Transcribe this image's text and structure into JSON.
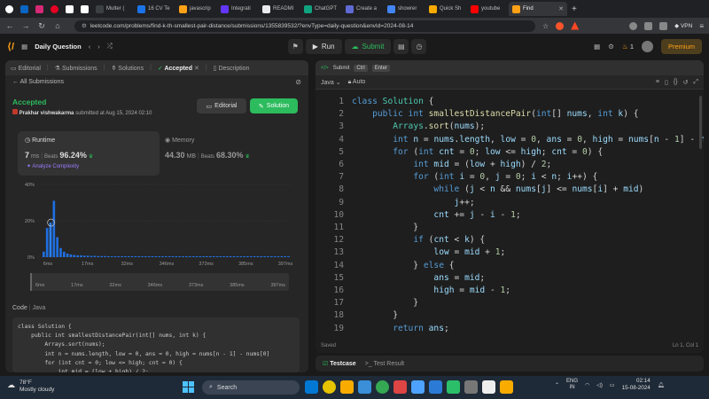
{
  "browser": {
    "tabs": [
      {
        "label": "Multer (",
        "color": "#3c4043"
      },
      {
        "label": "16 CV Te",
        "color": "#1a73e8"
      },
      {
        "label": "javascrip",
        "color": "#ffa116"
      },
      {
        "label": "Integrati",
        "color": "#6236ff"
      },
      {
        "label": "READMI",
        "color": "#e8eaed"
      },
      {
        "label": "ChatGPT",
        "color": "#10a37f"
      },
      {
        "label": "Create a",
        "color": "#5f6ad4"
      },
      {
        "label": "showrer",
        "color": "#4285f4"
      },
      {
        "label": "Quick Sh",
        "color": "#f9ab00"
      },
      {
        "label": "youtube",
        "color": "#ff0000"
      }
    ],
    "active_tab": "Find",
    "url": "leetcode.com/problems/find-k-th-smallest-pair-distance/submissions/1355839532/?envType=daily-question&envId=2024-08-14",
    "vpn_label": "VPN"
  },
  "header": {
    "title": "Daily Question",
    "run": "Run",
    "submit": "Submit",
    "streak": "1",
    "premium": "Premium"
  },
  "left": {
    "tabs": [
      "Editorial",
      "Submissions",
      "Solutions",
      "Accepted",
      "Description"
    ],
    "all_submissions": "All Submissions",
    "status": "Accepted",
    "user": "Prakhar vishwakarma",
    "submitted": "submitted at Aug 15, 2024 02:10",
    "editorial_btn": "Editorial",
    "solution_btn": "Solution",
    "runtime_label": "Runtime",
    "runtime_value": "7",
    "runtime_unit": "ms",
    "beats_label": "Beats",
    "runtime_beats": "96.24%",
    "analyze": "Analyze Complexity",
    "memory_label": "Memory",
    "memory_value": "44.30",
    "memory_unit": "MB",
    "memory_beats": "68.30%",
    "code_label": "Code",
    "code_lang": "Java",
    "code_preview": [
      "class Solution {",
      "    public int smallestDistancePair(int[] nums, int k) {",
      "        Arrays.sort(nums);",
      "        int n = nums.length, low = 0, ans = 0, high = nums[n - 1] - nums[0]",
      "        for (int cnt = 0; low <= high; cnt = 0) {",
      "            int mid = (low + high) / 2;"
    ]
  },
  "chart_data": {
    "type": "bar",
    "title": "",
    "xlabel": "",
    "ylabel": "",
    "ylim": [
      0,
      40
    ],
    "ytick_labels": [
      "40%",
      "20%",
      "0%"
    ],
    "xtick_labels": [
      "6ms",
      "17ms",
      "32ms",
      "346ms",
      "373ms",
      "385ms",
      "397ms"
    ],
    "highlight_index": 2,
    "highlight_color": "#2882ff",
    "bar_color": "#1f6fe0",
    "values": [
      3,
      16,
      19,
      31,
      11,
      5,
      3,
      2,
      1.5,
      1.2,
      1,
      1,
      0.8,
      0.8,
      0.7,
      0.7,
      0.6,
      0.6,
      0.6,
      0.5,
      0.5,
      0.5,
      0.5,
      0.5,
      0.5,
      0.5,
      0.5,
      0.5,
      0.5,
      0.5,
      0.5,
      0.5,
      0.5,
      0.5,
      0.5,
      0.5,
      0.5,
      0.5,
      0.5,
      0.5,
      0.5,
      0.5,
      0.5,
      0.5,
      0.5,
      0.5,
      0.5,
      0.5,
      0.5,
      0.5,
      0.5,
      0.5,
      0.5,
      0.5,
      0.5,
      0.5,
      0.5,
      0.5,
      0.5,
      0.5,
      0.5,
      0.5,
      0.5,
      0.5,
      0.5,
      0.5,
      0.5,
      0.5,
      0.5,
      0.5,
      0.5,
      0.5,
      0.5
    ]
  },
  "editor": {
    "tabs": {
      "submit": "Submit",
      "ctrl": "Ctrl",
      "enter": "Enter"
    },
    "language": "Java",
    "auto": "Auto",
    "saved": "Saved",
    "cursor": "Ln 1, Col 1",
    "lines": [
      {
        "n": "1",
        "html": "<span class='kw'>class</span> <span class='ty'>Solution</span> {"
      },
      {
        "n": "2",
        "html": "    <span class='kw'>public int</span> <span class='fn'>smallestDistancePair</span>(<span class='kw'>int</span>[] <span class='vr'>nums</span>, <span class='kw'>int</span> <span class='vr'>k</span>) {"
      },
      {
        "n": "3",
        "html": "        <span class='ty'>Arrays</span>.<span class='fn'>sort</span>(<span class='vr'>nums</span>);"
      },
      {
        "n": "4",
        "html": "        <span class='kw'>int</span> <span class='vr'>n</span> = <span class='vr'>nums</span>.<span class='vr'>length</span>, <span class='vr'>low</span> = <span class='nm'>0</span>, <span class='vr'>ans</span> = <span class='nm'>0</span>, <span class='vr'>high</span> = <span class='vr'>nums</span>[<span class='vr'>n</span> - <span class='nm'>1</span>] - <span class='vr'>nu</span>"
      },
      {
        "n": "5",
        "html": "        <span class='kw'>for</span> (<span class='kw'>int</span> <span class='vr'>cnt</span> = <span class='nm'>0</span>; <span class='vr'>low</span> &lt;= <span class='vr'>high</span>; <span class='vr'>cnt</span> = <span class='nm'>0</span>) {"
      },
      {
        "n": "6",
        "html": "            <span class='kw'>int</span> <span class='vr'>mid</span> = (<span class='vr'>low</span> + <span class='vr'>high</span>) / <span class='nm'>2</span>;"
      },
      {
        "n": "7",
        "html": "            <span class='kw'>for</span> (<span class='kw'>int</span> <span class='vr'>i</span> = <span class='nm'>0</span>, <span class='vr'>j</span> = <span class='nm'>0</span>; <span class='vr'>i</span> &lt; <span class='vr'>n</span>; <span class='vr'>i</span>++) {"
      },
      {
        "n": "8",
        "html": "                <span class='kw'>while</span> (<span class='vr'>j</span> &lt; <span class='vr'>n</span> &amp;&amp; <span class='vr'>nums</span>[<span class='vr'>j</span>] &lt;= <span class='vr'>nums</span>[<span class='vr'>i</span>] + <span class='vr'>mid</span>)"
      },
      {
        "n": "9",
        "html": "                    <span class='vr'>j</span>++;"
      },
      {
        "n": "10",
        "html": "                <span class='vr'>cnt</span> += <span class='vr'>j</span> - <span class='vr'>i</span> - <span class='nm'>1</span>;"
      },
      {
        "n": "11",
        "html": "            }"
      },
      {
        "n": "12",
        "html": "            <span class='kw'>if</span> (<span class='vr'>cnt</span> &lt; <span class='vr'>k</span>) {"
      },
      {
        "n": "13",
        "html": "                <span class='vr'>low</span> = <span class='vr'>mid</span> + <span class='nm'>1</span>;"
      },
      {
        "n": "14",
        "html": "            } <span class='kw'>else</span> {"
      },
      {
        "n": "15",
        "html": "                <span class='vr'>ans</span> = <span class='vr'>mid</span>;"
      },
      {
        "n": "16",
        "html": "                <span class='vr'>high</span> = <span class='vr'>mid</span> - <span class='nm'>1</span>;"
      },
      {
        "n": "17",
        "html": "            }"
      },
      {
        "n": "18",
        "html": "        }"
      },
      {
        "n": "19",
        "html": "        <span class='kw'>return</span> <span class='vr'>ans</span>;"
      }
    ]
  },
  "bottom": {
    "testcase": "Testcase",
    "result": "Test Result"
  },
  "taskbar": {
    "temp": "78°F",
    "weather": "Mostly cloudy",
    "search": "Search",
    "lang1": "ENG",
    "lang2": "IN",
    "time": "02:14",
    "date": "15-08-2024",
    "apps": [
      "#0078d4",
      "#e6c200",
      "#f9ab00",
      "#3a8fd8",
      "#34a853",
      "#d44",
      "#4da3ff",
      "#2b7bd6",
      "#2bbf6a",
      "#777",
      "#eee",
      "#f9ab00"
    ]
  }
}
